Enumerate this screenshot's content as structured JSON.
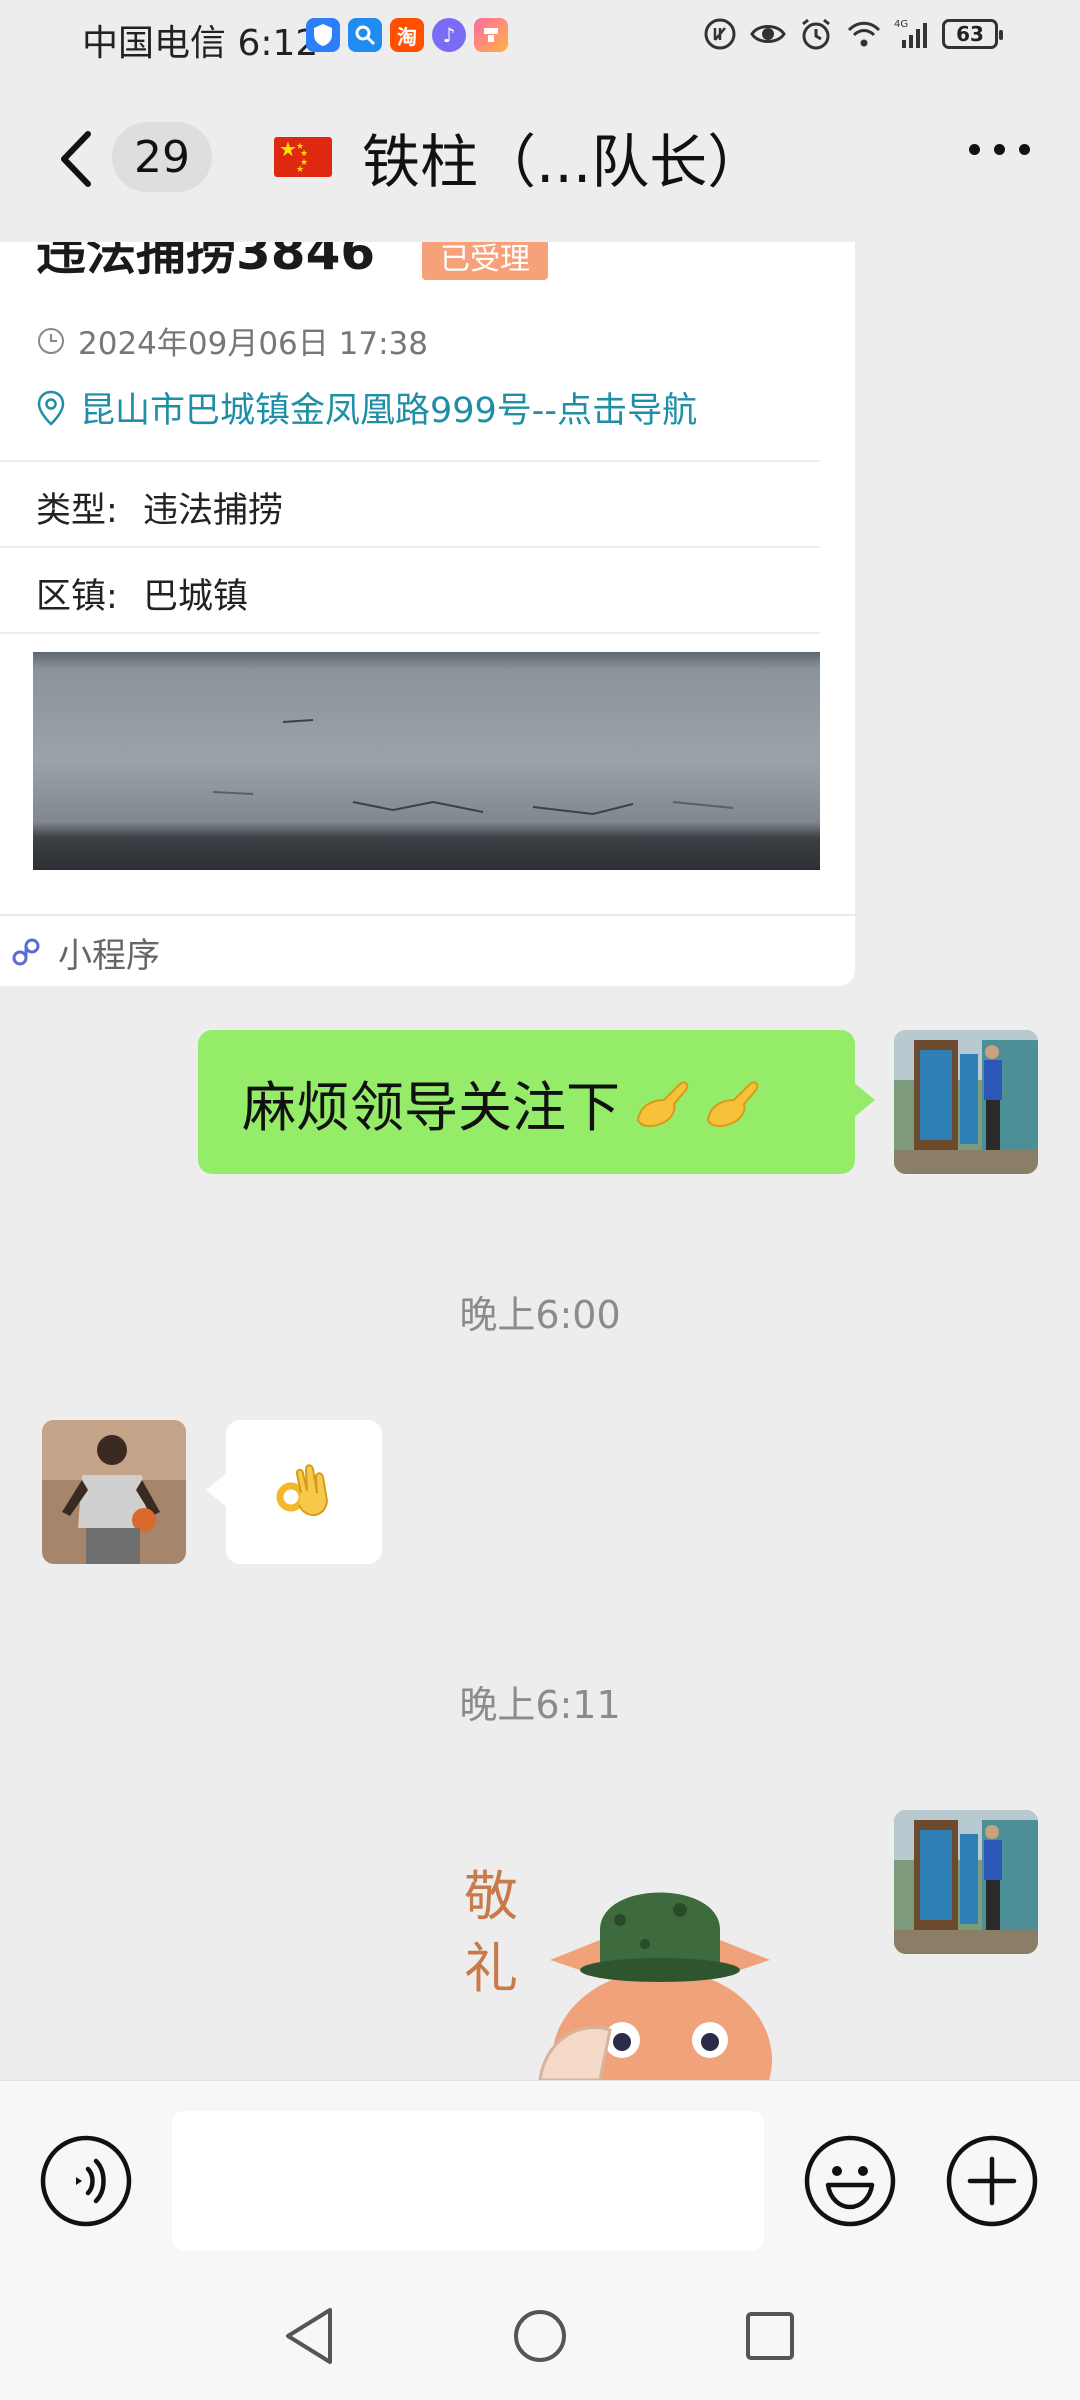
{
  "status_bar": {
    "carrier": "中国电信",
    "time": "6:12",
    "app_icon_taobao": "淘",
    "battery": "63"
  },
  "header": {
    "unread_count": "29",
    "title": "铁柱（...队长）"
  },
  "card": {
    "title": "违法捕捞3846",
    "status_badge": "已受理",
    "datetime": "2024年09月06日 17:38",
    "address": "昆山市巴城镇金凤凰路999号--点击导航",
    "type_label": "类型:",
    "type_value": "违法捕捞",
    "town_label": "区镇:",
    "town_value": "巴城镇",
    "footer_label": "小程序"
  },
  "messages": {
    "sent_text": "麻烦领导关注下",
    "time_1": "晚上6:00",
    "time_2": "晚上6:11",
    "sticker_text_line1": "敬",
    "sticker_text_line2": "礼"
  },
  "input": {
    "placeholder": ""
  },
  "colors": {
    "sent_bubble": "#95ec69",
    "address_link": "#1e8fa6",
    "badge": "#f6a17a",
    "background": "#ededed"
  }
}
